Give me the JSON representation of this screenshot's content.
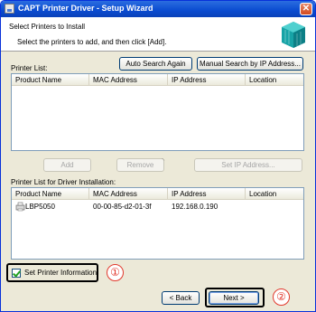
{
  "window": {
    "title": "CAPT Printer Driver - Setup Wizard",
    "close_glyph": "✕"
  },
  "header": {
    "title": "Select Printers to Install",
    "subtitle": "Select the printers to add, and then click [Add]."
  },
  "printer_list": {
    "label": "Printer List:",
    "auto_search_label": "Auto Search Again",
    "manual_search_label": "Manual Search by IP Address...",
    "columns": [
      "Product Name",
      "MAC Address",
      "IP Address",
      "Location"
    ],
    "rows": []
  },
  "middle_buttons": {
    "add_label": "Add",
    "arrows": "↓↑",
    "remove_label": "Remove",
    "set_ip_label": "Set IP Address..."
  },
  "install_list": {
    "label": "Printer List for Driver Installation:",
    "columns": [
      "Product Name",
      "MAC Address",
      "IP Address",
      "Location"
    ],
    "rows": [
      {
        "product": "LBP5050",
        "mac": "00-00-85-d2-01-3f",
        "ip": "192.168.0.190",
        "location": ""
      }
    ]
  },
  "options": {
    "set_printer_info_label": "Set Printer Information",
    "set_printer_info_checked": true
  },
  "footer": {
    "back_label": "< Back",
    "next_label": "Next >"
  },
  "callouts": {
    "one": "①",
    "two": "②"
  },
  "colors": {
    "titlebar": "#0a4bd0",
    "dialog_bg": "#ece9d8",
    "callout": "#e23a2e"
  }
}
